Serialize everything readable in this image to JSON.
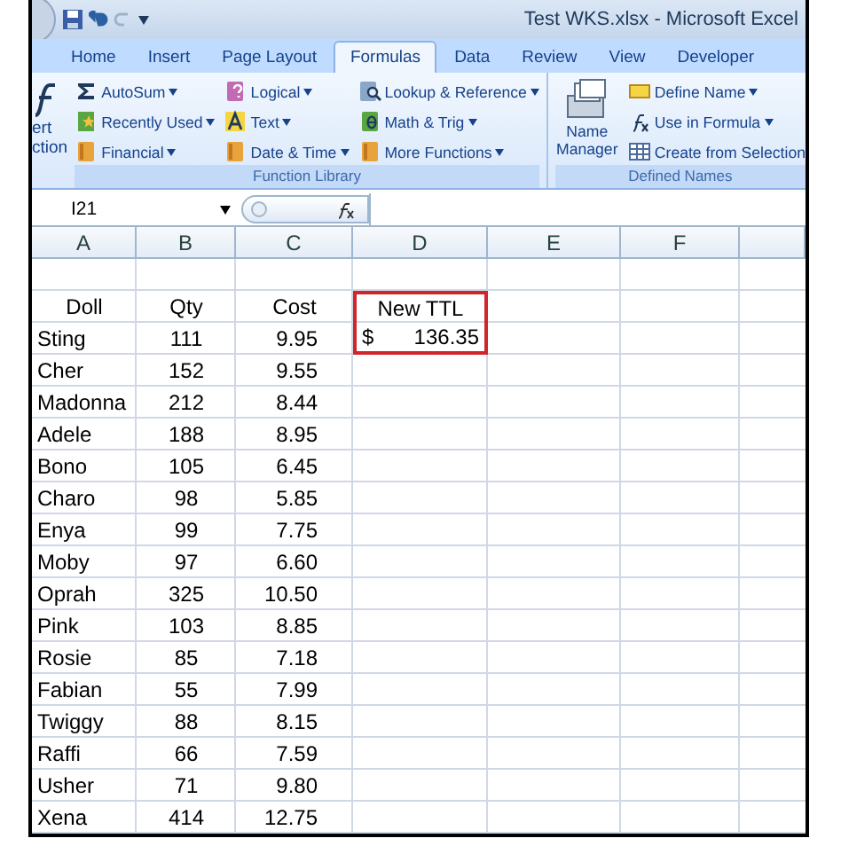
{
  "window": {
    "title": "Test WKS.xlsx - Microsoft Excel"
  },
  "tabs": [
    {
      "label": "Home",
      "selected": false
    },
    {
      "label": "Insert",
      "selected": false
    },
    {
      "label": "Page Layout",
      "selected": false
    },
    {
      "label": "Formulas",
      "selected": true
    },
    {
      "label": "Data",
      "selected": false
    },
    {
      "label": "Review",
      "selected": false
    },
    {
      "label": "View",
      "selected": false
    },
    {
      "label": "Developer",
      "selected": false
    }
  ],
  "ribbon": {
    "insert_function": [
      "ert",
      "ction"
    ],
    "groups": [
      {
        "label": "Function Library",
        "columns": [
          [
            {
              "label": "AutoSum",
              "kind": "sigma"
            },
            {
              "label": "Recently Used",
              "kind": "star"
            },
            {
              "label": "Financial",
              "kind": "book"
            }
          ],
          [
            {
              "label": "Logical",
              "kind": "question"
            },
            {
              "label": "Text",
              "kind": "text"
            },
            {
              "label": "Date & Time",
              "kind": "book"
            }
          ],
          [
            {
              "label": "Lookup & Reference",
              "kind": "lookup"
            },
            {
              "label": "Math & Trig",
              "kind": "theta"
            },
            {
              "label": "More Functions",
              "kind": "book"
            }
          ]
        ]
      },
      {
        "label": "Defined Names",
        "large": "Name Manager",
        "columns": [
          [
            {
              "label": "Define Name",
              "kind": "tag",
              "dropdown": true
            },
            {
              "label": "Use in Formula",
              "kind": "fx",
              "dropdown": true
            },
            {
              "label": "Create from Selection",
              "kind": "grid",
              "dropdown": false
            }
          ]
        ]
      }
    ]
  },
  "formula_bar": {
    "name_box": "I21"
  },
  "columns": [
    "A",
    "B",
    "C",
    "D",
    "E",
    "F"
  ],
  "header": {
    "doll": "Doll",
    "qty": "Qty",
    "cost": "Cost",
    "new_ttl": "New TTL"
  },
  "total_outlined": true,
  "rows": [
    {
      "doll": "Sting",
      "qty": "111",
      "cost": "9.95",
      "currency": "$",
      "new_ttl": "136.35"
    },
    {
      "doll": "Cher",
      "qty": "152",
      "cost": "9.55"
    },
    {
      "doll": "Madonna",
      "qty": "212",
      "cost": "8.44"
    },
    {
      "doll": "Adele",
      "qty": "188",
      "cost": "8.95"
    },
    {
      "doll": "Bono",
      "qty": "105",
      "cost": "6.45"
    },
    {
      "doll": "Charo",
      "qty": "98",
      "cost": "5.85"
    },
    {
      "doll": "Enya",
      "qty": "99",
      "cost": "7.75"
    },
    {
      "doll": "Moby",
      "qty": "97",
      "cost": "6.60"
    },
    {
      "doll": "Oprah",
      "qty": "325",
      "cost": "10.50"
    },
    {
      "doll": "Pink",
      "qty": "103",
      "cost": "8.85"
    },
    {
      "doll": "Rosie",
      "qty": "85",
      "cost": "7.18"
    },
    {
      "doll": "Fabian",
      "qty": "55",
      "cost": "7.99"
    },
    {
      "doll": "Twiggy",
      "qty": "88",
      "cost": "8.15"
    },
    {
      "doll": "Raffi",
      "qty": "66",
      "cost": "7.59"
    },
    {
      "doll": "Usher",
      "qty": "71",
      "cost": "9.80"
    },
    {
      "doll": "Xena",
      "qty": "414",
      "cost": "12.75"
    }
  ]
}
